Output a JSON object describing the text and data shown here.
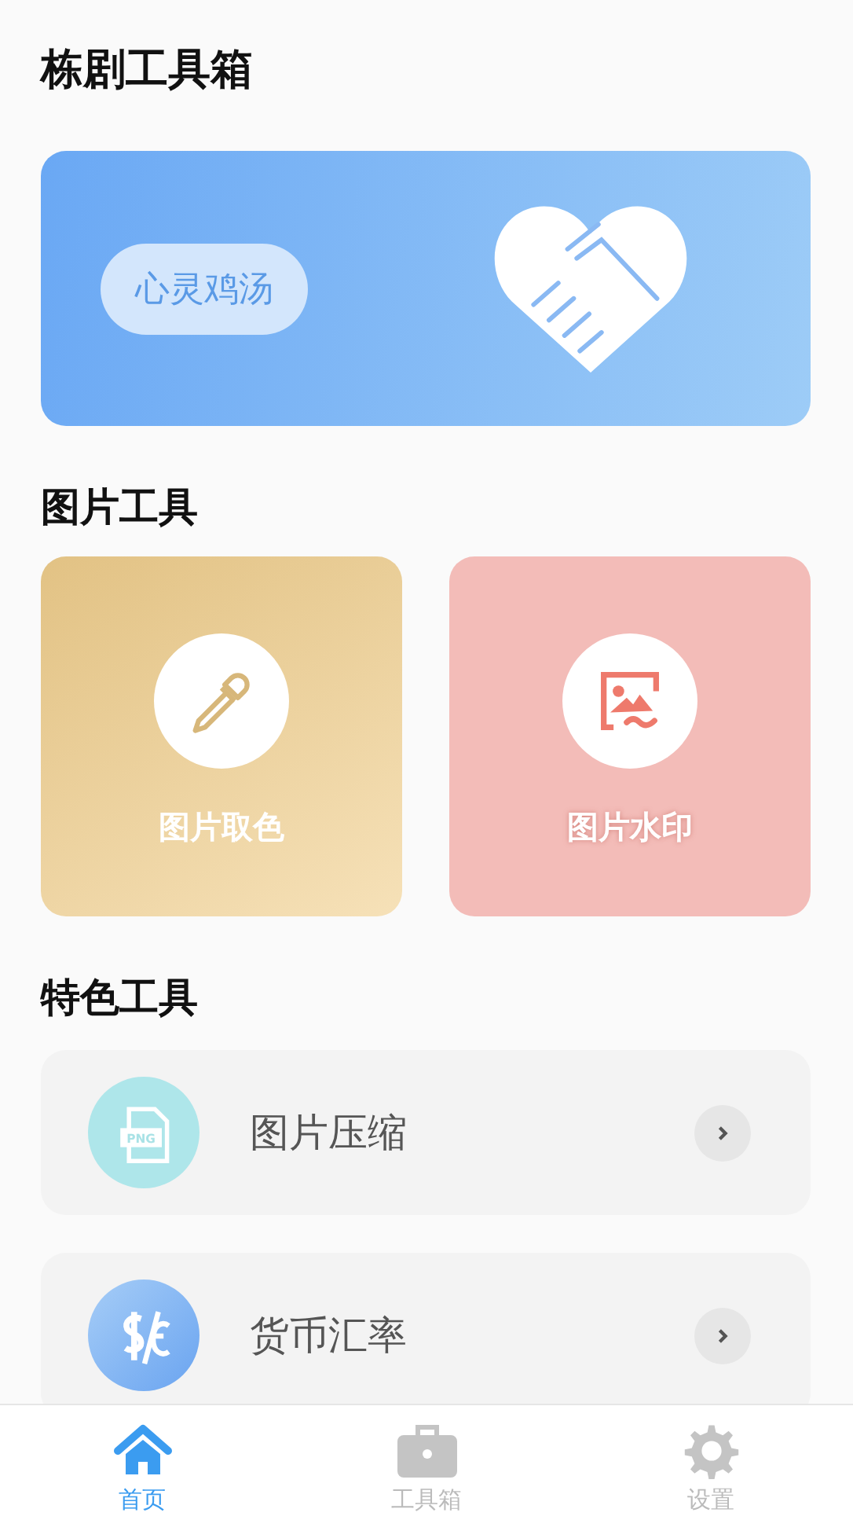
{
  "title": "栋剧工具箱",
  "banner": {
    "label": "心灵鸡汤"
  },
  "sections": [
    {
      "title": "图片工具"
    },
    {
      "title": "特色工具"
    }
  ],
  "image_tools": [
    {
      "label": "图片取色",
      "kind": "dropper"
    },
    {
      "label": "图片水印",
      "kind": "watermark"
    }
  ],
  "features": [
    {
      "label": "图片压缩",
      "kind": "png",
      "icon_text": "PNG"
    },
    {
      "label": "货币汇率",
      "kind": "currency"
    }
  ],
  "tabs": [
    {
      "label": "首页",
      "kind": "home",
      "selected": true
    },
    {
      "label": "工具箱",
      "kind": "toolbox",
      "selected": false
    },
    {
      "label": "设置",
      "kind": "settings",
      "selected": false
    }
  ]
}
